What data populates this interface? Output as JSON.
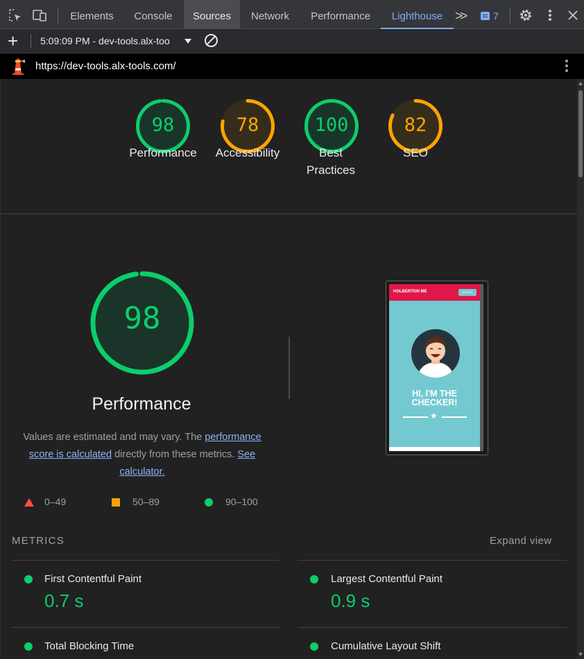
{
  "devtools": {
    "tabs": [
      {
        "label": "Elements"
      },
      {
        "label": "Console"
      },
      {
        "label": "Sources"
      },
      {
        "label": "Network"
      },
      {
        "label": "Performance"
      },
      {
        "label": "Lighthouse"
      }
    ],
    "more_tabs": ">>",
    "issues_count": "7",
    "icons": [
      "inspect-element-icon",
      "device-toolbar-icon",
      "chat-icon",
      "gear-icon",
      "kebab-menu-icon",
      "close-icon"
    ]
  },
  "toolbar": {
    "add": "+",
    "report_label": "5:09:09 PM - dev-tools.alx-too"
  },
  "urlbar": {
    "url": "https://dev-tools.alx-tools.com/"
  },
  "colors": {
    "pass": "#0cce6b",
    "average": "#ffa400",
    "fail": "#ff4e42",
    "link": "#8ab4f8"
  },
  "categories": [
    {
      "label": "Performance",
      "score": 98,
      "status": "pass"
    },
    {
      "label": "Accessibility",
      "score": 78,
      "status": "average"
    },
    {
      "label": "Best Practices",
      "score": 100,
      "status": "pass"
    },
    {
      "label": "SEO",
      "score": 82,
      "status": "average"
    }
  ],
  "performance": {
    "score": "98",
    "score_fraction": 0.98,
    "title": "Performance",
    "desc_prefix": "Values are estimated and may vary. The ",
    "desc_link1": "performance score is calculated",
    "desc_mid": " directly from these metrics. ",
    "desc_link2": "See calculator."
  },
  "legend": [
    {
      "range": "0–49",
      "shape": "triangle"
    },
    {
      "range": "50–89",
      "shape": "square"
    },
    {
      "range": "90–100",
      "shape": "circle"
    }
  ],
  "screenshot": {
    "brand": "HOLBERTON ME",
    "button": "SIGN IN",
    "heading_line1": "HI, I'M THE",
    "heading_line2": "CHECKER!"
  },
  "metrics": {
    "title": "METRICS",
    "expand_label": "Expand view",
    "items": [
      {
        "label": "First Contentful Paint",
        "value": "0.7 s"
      },
      {
        "label": "Largest Contentful Paint",
        "value": "0.9 s"
      },
      {
        "label": "Total Blocking Time",
        "value": ""
      },
      {
        "label": "Cumulative Layout Shift",
        "value": ""
      }
    ]
  }
}
